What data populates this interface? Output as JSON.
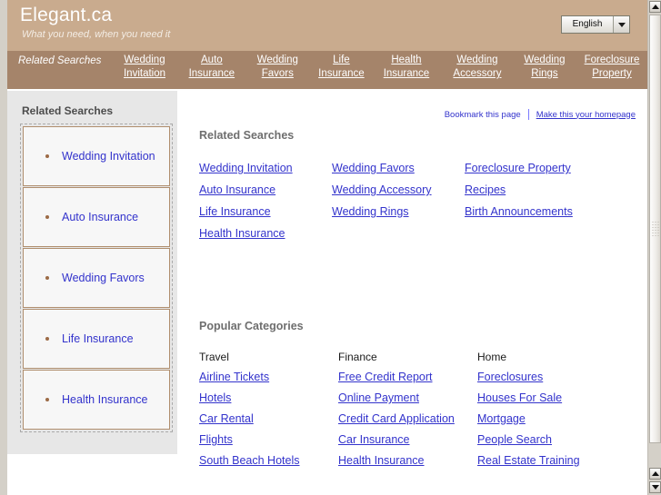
{
  "header": {
    "brand_title": "Elegant.ca",
    "tagline": "What you need, when you need it",
    "language_value": "English"
  },
  "navbar": {
    "label": "Related Searches",
    "items": [
      "Wedding Invitation",
      "Auto Insurance",
      "Wedding Favors",
      "Life Insurance",
      "Health Insurance",
      "Wedding Accessory",
      "Wedding Rings",
      "Foreclosure Property"
    ]
  },
  "sidebar": {
    "title": "Related Searches",
    "items": [
      "Wedding Invitation",
      "Auto Insurance",
      "Wedding Favors",
      "Life Insurance",
      "Health Insurance"
    ]
  },
  "topbar": {
    "bookmark_label": "Bookmark this page",
    "homepage_label": "Make this your homepage"
  },
  "related": {
    "heading": "Related Searches",
    "links": [
      "Wedding Invitation",
      "Wedding Favors",
      "Foreclosure Property",
      "Auto Insurance",
      "Wedding Accessory",
      "Recipes",
      "Life Insurance",
      "Wedding Rings",
      "Birth Announcements",
      "Health Insurance"
    ]
  },
  "popular": {
    "heading": "Popular Categories",
    "columns": [
      {
        "title": "Travel",
        "links": [
          "Airline Tickets",
          "Hotels",
          "Car Rental",
          "Flights",
          "South Beach Hotels"
        ]
      },
      {
        "title": "Finance",
        "links": [
          "Free Credit Report",
          "Online Payment",
          "Credit Card Application",
          "Car Insurance",
          "Health Insurance"
        ]
      },
      {
        "title": "Home",
        "links": [
          "Foreclosures",
          "Houses For Sale",
          "Mortgage",
          "People Search",
          "Real Estate Training"
        ]
      }
    ]
  },
  "colors": {
    "header_bg": "#c9ab8e",
    "nav_bg": "#a5846a",
    "link": "#3333cc",
    "sidebar_bg": "#e7e7e7",
    "box_border": "#b08e6e"
  }
}
